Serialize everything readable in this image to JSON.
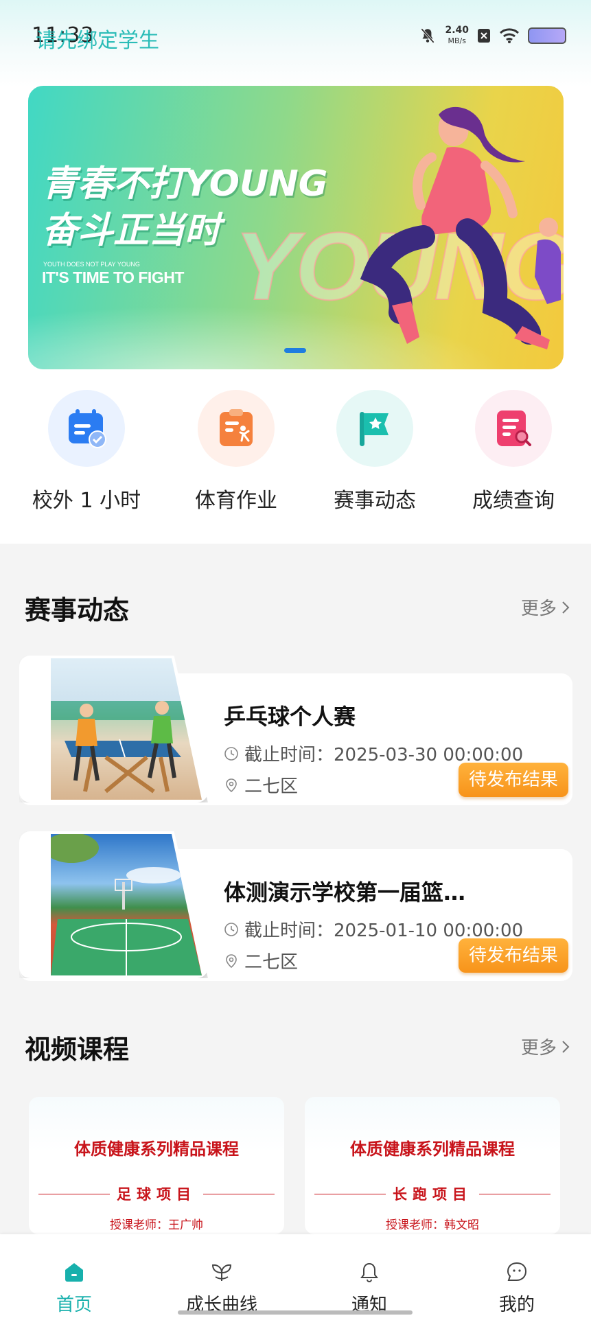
{
  "status_bar": {
    "time": "11:33",
    "bind_prompt": "请先绑定学生",
    "net_speed_value": "2.40",
    "net_speed_unit": "MB/s"
  },
  "banner": {
    "line1": "青春不打YOUNG",
    "line2": "奋斗正当时",
    "small_text": "YOUTH DOES NOT PLAY YOUNG",
    "english": "IT'S TIME TO FIGHT",
    "watermark": "YOUNG",
    "active_slide": 1
  },
  "quick_menu": [
    {
      "label": "校外 1 小时",
      "icon": "calendar-check-icon",
      "bg": "#eaf2ff"
    },
    {
      "label": "体育作业",
      "icon": "clipboard-runner-icon",
      "bg": "#fff0ea"
    },
    {
      "label": "赛事动态",
      "icon": "flag-star-icon",
      "bg": "#e6f8f6"
    },
    {
      "label": "成绩查询",
      "icon": "document-search-icon",
      "bg": "#fdeef3"
    }
  ],
  "events_section": {
    "title": "赛事动态",
    "more": "更多",
    "items": [
      {
        "title": "乒乓球个人赛",
        "deadline": "截止时间：2025-03-30 00:00:00",
        "location": "二七区",
        "status": "待发布结果"
      },
      {
        "title": "体测演示学校第一届篮…",
        "deadline": "截止时间：2025-01-10 00:00:00",
        "location": "二七区",
        "status": "待发布结果"
      }
    ]
  },
  "video_section": {
    "title": "视频课程",
    "more": "更多",
    "items": [
      {
        "series": "体质健康系列精品课程",
        "sport": "足球项目",
        "teacher": "授课老师：王广帅"
      },
      {
        "series": "体质健康系列精品课程",
        "sport": "长跑项目",
        "teacher": "授课老师：韩文昭"
      }
    ]
  },
  "tab_bar": [
    {
      "label": "首页",
      "icon": "home-icon",
      "active": true
    },
    {
      "label": "成长曲线",
      "icon": "sprout-icon",
      "active": false
    },
    {
      "label": "通知",
      "icon": "bell-icon",
      "active": false
    },
    {
      "label": "我的",
      "icon": "profile-icon",
      "active": false
    }
  ],
  "colors": {
    "accent": "#17b0ac",
    "badge": "#f7931a",
    "video_red": "#c8141b"
  }
}
